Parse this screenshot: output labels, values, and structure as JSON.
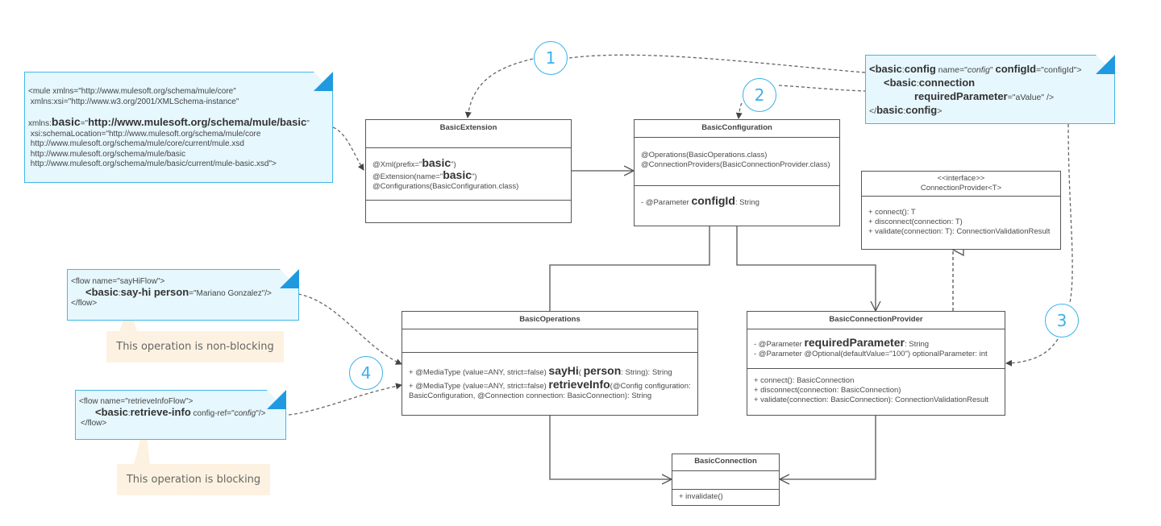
{
  "notes": {
    "namespace": {
      "line1": "<mule xmlns=\"http://www.mulesoft.org/schema/mule/core\"",
      "line2": " xmlns:xsi=\"http://www.w3.org/2001/XMLSchema-instance\"",
      "line3_prefix": "xmlns:",
      "line3_key": "basic",
      "line3_eq": "=\"",
      "line3_url": "http://www.mulesoft.org/schema/mule/basic",
      "line3_end": "\"",
      "line4": " xsi:schemaLocation=\"http://www.mulesoft.org/schema/mule/core",
      "line5": " http://www.mulesoft.org/schema/mule/core/current/mule.xsd",
      "line6": " http://www.mulesoft.org/schema/mule/basic",
      "line7": " http://www.mulesoft.org/schema/mule/basic/current/mule-basic.xsd\">"
    },
    "config": {
      "l1_open": "<",
      "l1_ns": "basic",
      "l1_colon": ":",
      "l1_tag": "config",
      "l1_attr1": " name=\"",
      "l1_attr1_val": "config",
      "l1_attr1_end": "\" ",
      "l1_attr2": "configId",
      "l1_attr2_val": "=\"configId\">",
      "l2_open": "<",
      "l2_ns": "basic",
      "l2_colon": ":",
      "l2_tag": "connection",
      "l3_attr": "requiredParameter",
      "l3_val": "=\"aValue\" />",
      "l4_open": "</",
      "l4_ns": "basic",
      "l4_colon": ":",
      "l4_tag": "config",
      "l4_close": ">"
    },
    "sayhi_flow": {
      "l1": "<flow name=\"sayHiFlow\">",
      "l2_open": "<",
      "l2_ns": "basic",
      "l2_colon": ":",
      "l2_tag": "say-hi",
      "l2_attr": " person",
      "l2_val": "=\"Mariano Gonzalez\"/>",
      "l3": "</flow>"
    },
    "retrieve_flow": {
      "l1": "<flow name=\"retrieveInfoFlow\">",
      "l2_open": "<",
      "l2_ns": "basic",
      "l2_colon": ":",
      "l2_tag": "retrieve-info",
      "l2_attr": " config-ref=\"",
      "l2_val": "config",
      "l2_end": "\"/>",
      "l3": "</flow>"
    }
  },
  "callouts": {
    "non_blocking": "This operation is non-blocking",
    "blocking": "This operation is blocking"
  },
  "badges": [
    "1",
    "2",
    "3",
    "4"
  ],
  "classes": {
    "basic_extension": {
      "name": "BasicExtension",
      "a1_pre": "@Xml(prefix=\"",
      "a1_big": "basic",
      "a1_post": "\")",
      "a2_pre": "@Extension(name=\"",
      "a2_big": "basic",
      "a2_post": "\")",
      "a3": "@Configurations(BasicConfiguration.class)"
    },
    "basic_configuration": {
      "name": "BasicConfiguration",
      "a1": "@Operations(BasicOperations.class)",
      "a2": "@ConnectionProviders(BasicConnectionProvider.class)",
      "f1_pre": "- @Parameter ",
      "f1_big": "configId",
      "f1_post": ": String"
    },
    "connection_provider": {
      "stereotype": "<<interface>>",
      "name": "ConnectionProvider<T>",
      "m1": "+ connect(): T",
      "m2": "+ disconnect(connection: T)",
      "m3": "+ validate(connection: T): ConnectionValidationResult"
    },
    "basic_operations": {
      "name": "BasicOperations",
      "m1_pre": "+ @MediaType (value=ANY, strict=false) ",
      "m1_big": "sayHi",
      "m1_mid": "( ",
      "m1_big2": "person",
      "m1_post": ": String): String",
      "m2_pre": "+ @MediaType (value=ANY, strict=false)  ",
      "m2_big": "retrieveInfo",
      "m2_post": "(@Config configuration: BasicConfiguration, @Connection connection: BasicConnection): String"
    },
    "basic_connection_provider": {
      "name": "BasicConnectionProvider",
      "f1_pre": "- @Parameter ",
      "f1_big": "requiredParameter",
      "f1_post": ": String",
      "f2": "- @Parameter @Optional(defaultValue=\"100\")  optionalParameter: int",
      "m1": "+ connect(): BasicConnection",
      "m2": "+ disconnect(connection: BasicConnection)",
      "m3": "+ validate(connection: BasicConnection): ConnectionValidationResult"
    },
    "basic_connection": {
      "name": "BasicConnection",
      "m1": "+ invalidate()"
    }
  }
}
